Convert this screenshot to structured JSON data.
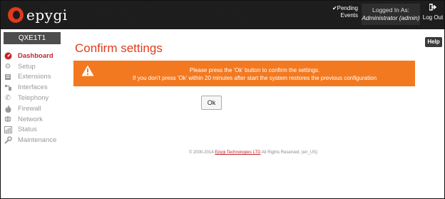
{
  "header": {
    "logo_text": "epygi",
    "pending_events_line1": "Pending",
    "pending_events_line2": "Events",
    "logged_in_label": "Logged In As:",
    "logged_in_user": "Administrator (admin)",
    "logout_label": "Log Out"
  },
  "sidebar": {
    "device_name": "QXE1T1",
    "items": [
      {
        "label": "Dashboard",
        "icon": "dashboard-icon"
      },
      {
        "label": "Setup",
        "icon": "gear-icon"
      },
      {
        "label": "Extensions",
        "icon": "extensions-icon"
      },
      {
        "label": "Interfaces",
        "icon": "interfaces-icon"
      },
      {
        "label": "Telephony",
        "icon": "phone-icon"
      },
      {
        "label": "Firewall",
        "icon": "flame-icon"
      },
      {
        "label": "Network",
        "icon": "globe-icon"
      },
      {
        "label": "Status",
        "icon": "chart-icon"
      },
      {
        "label": "Maintenance",
        "icon": "wrench-icon"
      }
    ]
  },
  "main": {
    "title": "Confirm settings",
    "help_label": "Help",
    "alert_line1": "Please press the 'Ok' button to confirm the settings.",
    "alert_line2": "If you don't press 'Ok' within 20 minutes after start the system restores the previous configuration",
    "ok_label": "Ok"
  },
  "footer": {
    "prefix": "© 2000-2014",
    "company": "Epygi Technologies LTD",
    "suffix": "All Rights Reserved. (en_US)"
  },
  "colors": {
    "accent": "#e03c1a",
    "alert_bg": "#f37921",
    "header_bg": "#1b1b1b",
    "active_nav": "#c1272d"
  }
}
